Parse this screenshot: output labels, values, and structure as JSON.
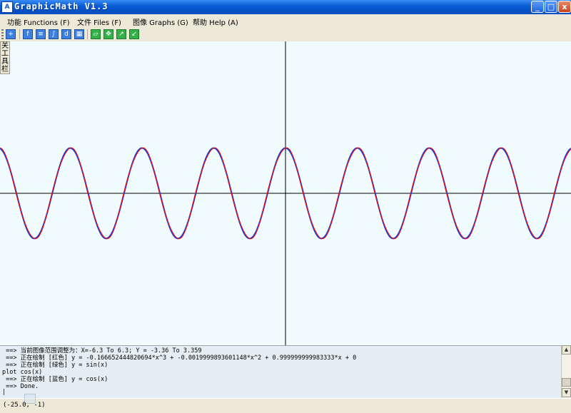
{
  "window": {
    "title": "GraphicMath V1.3",
    "icon_label": "A"
  },
  "controls": {
    "minimize": "_",
    "maximize": "□",
    "close": "x"
  },
  "menu": [
    {
      "label": "功能 Functions (F)"
    },
    {
      "label": "文件 Files (F)"
    },
    {
      "label": "图像 Graphs (G)"
    },
    {
      "label": "帮助 Help (A)"
    }
  ],
  "toolbar": {
    "icons": [
      "add-graph-icon",
      "function-icon",
      "list-icon",
      "integral-icon",
      "derivative-icon",
      "table-icon",
      "zoom-in-icon",
      "pan-icon",
      "fit-icon",
      "reset-icon"
    ]
  },
  "side_tab": {
    "chars": [
      "关",
      "工",
      "具",
      "栏"
    ]
  },
  "graph": {
    "xlim": [
      -25.0,
      25.0
    ],
    "ylim": [
      -3.36,
      3.359
    ],
    "functions": [
      {
        "expr": "-0.166652444820694*x^3 + -0.0019999893601148*x^2 + 0.999999999983333*x + 0",
        "color": "#e0101e"
      },
      {
        "expr": "sin(x)",
        "color": "#13a22a"
      },
      {
        "expr": "cos(x)",
        "color": "#1a3ad8"
      }
    ],
    "axis_color": "#000000",
    "background": "#f0fbfd"
  },
  "console": {
    "lines": [
      " ==> 当前图像范围调整为：X=-6.3 To 6.3; Y = -3.36 To 3.359",
      " ==> 正在绘制 [红色] y = -0.166652444820694*x^3 + -0.0019999893601148*x^2 + 0.999999999983333*x + 0",
      " ==> 正在绘制 [绿色] y = sin(x)",
      "plot cos(x)",
      " ==> 正在绘制 [蓝色] y = cos(x)",
      " ==> Done.",
      "|"
    ]
  },
  "status": {
    "coordinates": "(-25.0, -1)"
  }
}
